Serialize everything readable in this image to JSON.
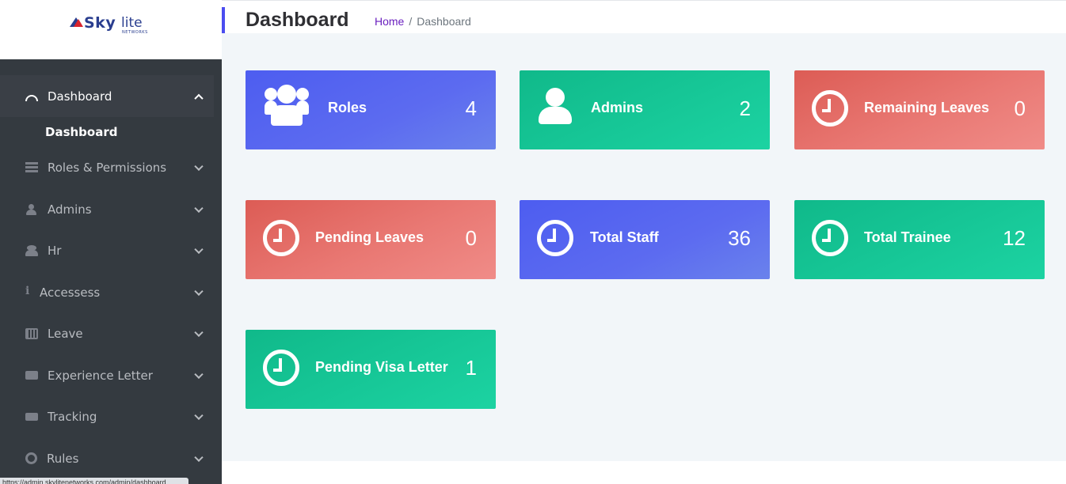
{
  "brand": {
    "name_bold": "Sky",
    "name_light": "lite",
    "sub": "NETWORKS"
  },
  "header": {
    "title": "Dashboard",
    "breadcrumb": {
      "home": "Home",
      "separator": "/",
      "current": "Dashboard"
    }
  },
  "sidebar": {
    "items": [
      {
        "label": "Dashboard",
        "icon": "dashboard-icon",
        "expanded": true
      },
      {
        "label": "Roles & Permissions",
        "icon": "list-icon"
      },
      {
        "label": "Admins",
        "icon": "user-icon"
      },
      {
        "label": "Hr",
        "icon": "users-icon"
      },
      {
        "label": "Accessess",
        "icon": "info-icon"
      },
      {
        "label": "Leave",
        "icon": "calendar-icon"
      },
      {
        "label": "Experience Letter",
        "icon": "envelope-icon"
      },
      {
        "label": "Tracking",
        "icon": "truck-icon"
      },
      {
        "label": "Rules",
        "icon": "life-ring-icon"
      }
    ],
    "sub_items": {
      "dashboard": "Dashboard"
    }
  },
  "cards": [
    {
      "label": "Roles",
      "count": "4",
      "icon": "users-icon",
      "color": "#4d5df0"
    },
    {
      "label": "Admins",
      "count": "2",
      "icon": "user-icon",
      "color": "#10b98a"
    },
    {
      "label": "Remaining Leaves",
      "count": "0",
      "icon": "clock-icon",
      "color": "#dc5c55"
    },
    {
      "label": "Pending Leaves",
      "count": "0",
      "icon": "clock-icon",
      "color": "#dc5c55"
    },
    {
      "label": "Total Staff",
      "count": "36",
      "icon": "clock-icon",
      "color": "#4d5df0"
    },
    {
      "label": "Total Trainee",
      "count": "12",
      "icon": "clock-icon",
      "color": "#10b98a"
    },
    {
      "label": "Pending Visa Letter",
      "count": "1",
      "icon": "clock-icon",
      "color": "#10b98a"
    }
  ],
  "status_bar": {
    "url": "https://admin.skylitenetworks.com/admin/dashboard"
  }
}
